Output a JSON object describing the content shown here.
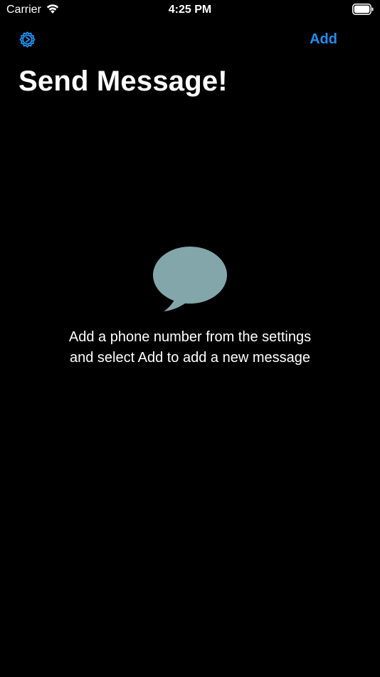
{
  "status_bar": {
    "carrier": "Carrier",
    "time": "4:25 PM",
    "wifi_icon": "wifi-icon",
    "battery_icon": "battery-icon"
  },
  "nav": {
    "settings_icon": "gear-icon",
    "add_label": "Add"
  },
  "title": "Send Message!",
  "empty_state": {
    "icon": "speech-bubble-icon",
    "message": "Add a phone number from the settings and select Add to add a new message"
  },
  "colors": {
    "background": "#000000",
    "accent": "#1e8ff0",
    "bubble": "#82a6aa",
    "text": "#ffffff"
  }
}
